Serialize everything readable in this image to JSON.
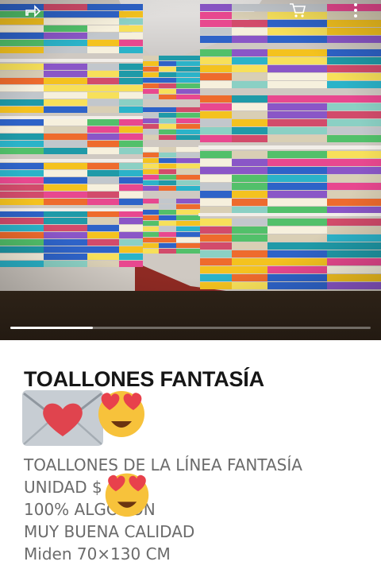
{
  "story": {
    "photo_alt": "",
    "progress": 0.23,
    "colors": {
      "band": "#2d2217",
      "progress_track": "#8f8f8f",
      "progress_fill": "#ffffff"
    },
    "icons": [
      "share-icon",
      "cart-icon",
      "more-vertical-icon"
    ]
  },
  "product": {
    "title": "TOALLONES FANTASÍA",
    "description_lines": [
      "TOALLONES DE LA LÍNEA FANTASÍA",
      "UNIDAD $",
      "100% ALGODÓN",
      "MUY BUENA CALIDAD",
      "Miden 70×130 CM"
    ],
    "stickers": [
      "love-letter-icon",
      "heart-eyes-icon",
      "heart-eyes-icon"
    ],
    "colors": {
      "title": "#161616",
      "text": "#6b6b6b"
    }
  }
}
